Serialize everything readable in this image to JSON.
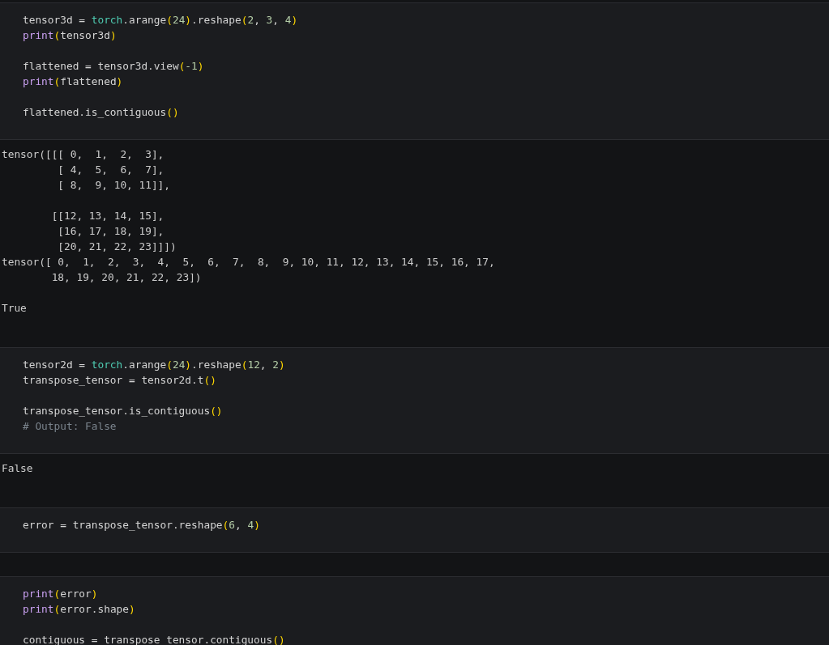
{
  "cells": [
    {
      "kind": "code",
      "blocks": [
        [
          [
            {
              "text": "tensor3d = ",
              "kind": "plain"
            },
            {
              "text": "torch",
              "kind": "module"
            },
            {
              "text": ".arange",
              "kind": "plain"
            },
            {
              "text": "(",
              "kind": "paren"
            },
            {
              "text": "24",
              "kind": "number"
            },
            {
              "text": ")",
              "kind": "paren"
            },
            {
              "text": ".reshape",
              "kind": "plain"
            },
            {
              "text": "(",
              "kind": "paren"
            },
            {
              "text": "2",
              "kind": "number"
            },
            {
              "text": ", ",
              "kind": "plain"
            },
            {
              "text": "3",
              "kind": "number"
            },
            {
              "text": ", ",
              "kind": "plain"
            },
            {
              "text": "4",
              "kind": "number"
            },
            {
              "text": ")",
              "kind": "paren"
            }
          ],
          [
            {
              "text": "print",
              "kind": "builtin"
            },
            {
              "text": "(",
              "kind": "paren"
            },
            {
              "text": "tensor3d",
              "kind": "plain"
            },
            {
              "text": ")",
              "kind": "paren"
            }
          ]
        ],
        [
          [
            {
              "text": "flattened = tensor3d.view",
              "kind": "plain"
            },
            {
              "text": "(",
              "kind": "paren"
            },
            {
              "text": "-1",
              "kind": "number"
            },
            {
              "text": ")",
              "kind": "paren"
            }
          ],
          [
            {
              "text": "print",
              "kind": "builtin"
            },
            {
              "text": "(",
              "kind": "paren"
            },
            {
              "text": "flattened",
              "kind": "plain"
            },
            {
              "text": ")",
              "kind": "paren"
            }
          ]
        ],
        [
          [
            {
              "text": "flattened.is_contiguous",
              "kind": "plain"
            },
            {
              "text": "()",
              "kind": "paren"
            }
          ]
        ]
      ]
    },
    {
      "kind": "output",
      "blocks": [
        [
          "tensor([[[ 0,  1,  2,  3],",
          "         [ 4,  5,  6,  7],",
          "         [ 8,  9, 10, 11]],"
        ],
        [
          "        [[12, 13, 14, 15],",
          "         [16, 17, 18, 19],",
          "         [20, 21, 22, 23]]])",
          "tensor([ 0,  1,  2,  3,  4,  5,  6,  7,  8,  9, 10, 11, 12, 13, 14, 15, 16, 17,",
          "        18, 19, 20, 21, 22, 23])"
        ],
        [
          "True"
        ]
      ]
    },
    {
      "kind": "code",
      "blocks": [
        [
          [
            {
              "text": "tensor2d = ",
              "kind": "plain"
            },
            {
              "text": "torch",
              "kind": "module"
            },
            {
              "text": ".arange",
              "kind": "plain"
            },
            {
              "text": "(",
              "kind": "paren"
            },
            {
              "text": "24",
              "kind": "number"
            },
            {
              "text": ")",
              "kind": "paren"
            },
            {
              "text": ".reshape",
              "kind": "plain"
            },
            {
              "text": "(",
              "kind": "paren"
            },
            {
              "text": "12",
              "kind": "number"
            },
            {
              "text": ", ",
              "kind": "plain"
            },
            {
              "text": "2",
              "kind": "number"
            },
            {
              "text": ")",
              "kind": "paren"
            }
          ],
          [
            {
              "text": "transpose_tensor = tensor2d.t",
              "kind": "plain"
            },
            {
              "text": "()",
              "kind": "paren"
            }
          ]
        ],
        [
          [
            {
              "text": "transpose_tensor.is_contiguous",
              "kind": "plain"
            },
            {
              "text": "()",
              "kind": "paren"
            }
          ],
          [
            {
              "text": "# Output: False",
              "kind": "comment"
            }
          ]
        ]
      ]
    },
    {
      "kind": "output",
      "blocks": [
        [
          "False"
        ]
      ]
    },
    {
      "kind": "code",
      "blocks": [
        [
          [
            {
              "text": "error = transpose_tensor.reshape",
              "kind": "plain"
            },
            {
              "text": "(",
              "kind": "paren"
            },
            {
              "text": "6",
              "kind": "number"
            },
            {
              "text": ", ",
              "kind": "plain"
            },
            {
              "text": "4",
              "kind": "number"
            },
            {
              "text": ")",
              "kind": "paren"
            }
          ]
        ]
      ]
    },
    {
      "kind": "empty_output"
    },
    {
      "kind": "code",
      "blocks": [
        [
          [
            {
              "text": "print",
              "kind": "builtin"
            },
            {
              "text": "(",
              "kind": "paren"
            },
            {
              "text": "error",
              "kind": "plain"
            },
            {
              "text": ")",
              "kind": "paren"
            }
          ],
          [
            {
              "text": "print",
              "kind": "builtin"
            },
            {
              "text": "(",
              "kind": "paren"
            },
            {
              "text": "error.shape",
              "kind": "plain"
            },
            {
              "text": ")",
              "kind": "paren"
            }
          ]
        ],
        [
          [
            {
              "text": "contiguous = transpose_tensor.contiguous",
              "kind": "plain"
            },
            {
              "text": "()",
              "kind": "paren"
            }
          ]
        ]
      ]
    }
  ]
}
